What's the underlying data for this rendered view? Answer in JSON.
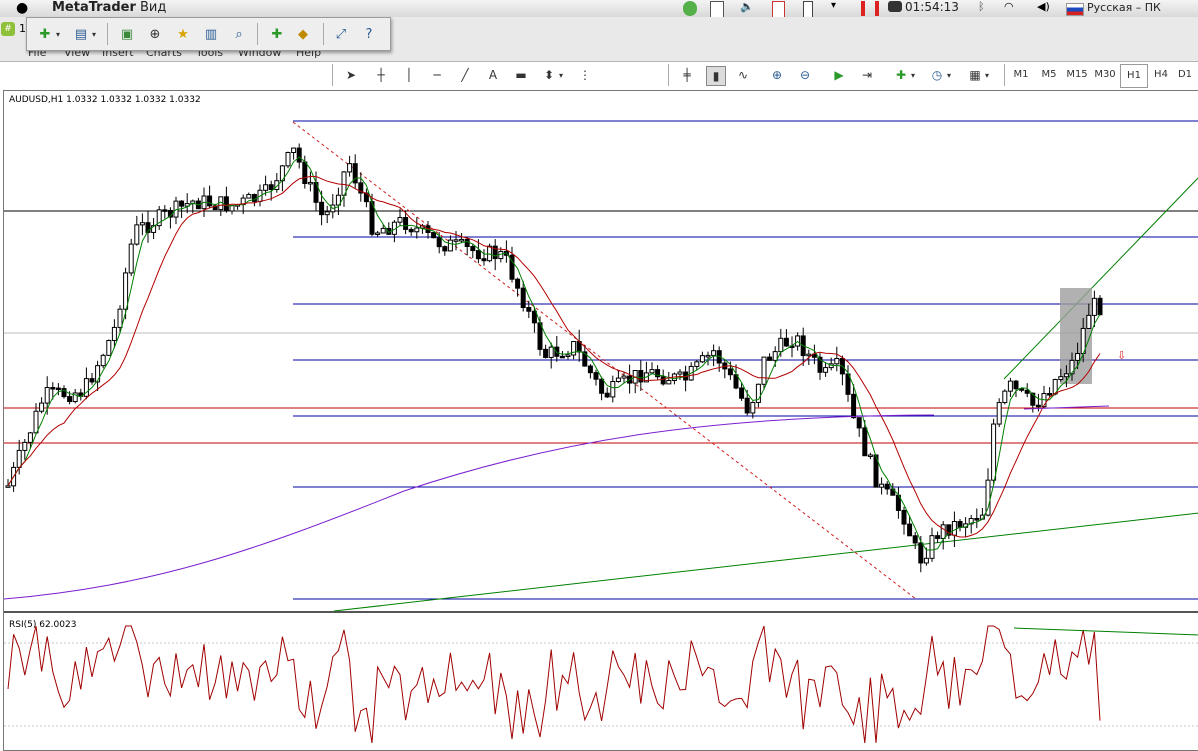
{
  "os_menubar": {
    "app_name": "MetaTrader",
    "view_menu": "Вид",
    "clock": "01:54:13",
    "input_language": "Русская – ПК"
  },
  "app_menu": {
    "workspace_badge": "1",
    "items": [
      "File",
      "View",
      "Insert",
      "Charts",
      "Tools",
      "Window",
      "Help"
    ]
  },
  "timeframes": [
    "M1",
    "M5",
    "M15",
    "M30",
    "H1",
    "H4",
    "D1"
  ],
  "active_timeframe": "H1",
  "chart": {
    "header": "AUDUSD,H1  1.0332 1.0332 1.0332 1.0332",
    "rsi_header": "RSI(5) 62.0023"
  },
  "colors": {
    "bull_candle": "#ffffff",
    "bear_candle": "#000000",
    "fast_ma": "#008000",
    "slow_ma": "#b40000",
    "long_ma": "#7b1fd0",
    "horizontal_blue": "#0000a0",
    "horizontal_red": "#c00000",
    "rsi_line": "#a00000"
  },
  "icons": [
    "new-chart-icon",
    "profiles-icon",
    "market-watch-icon",
    "crosshair-icon",
    "favorites-icon",
    "navigator-icon",
    "strategy-tester-icon",
    "new-order-icon",
    "expert-advisors-icon",
    "fullscreen-icon",
    "help-icon"
  ]
}
